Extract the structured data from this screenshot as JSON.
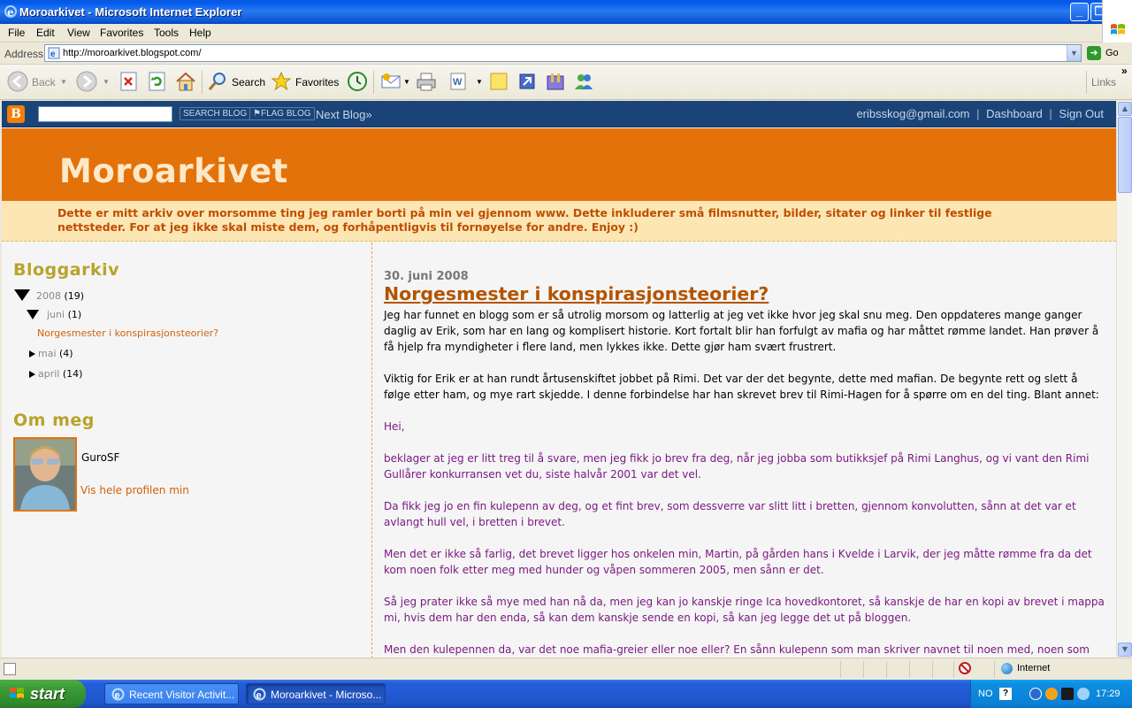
{
  "window": {
    "title": "Moroarkivet - Microsoft Internet Explorer",
    "min_glyph": "_",
    "max_glyph": "❐",
    "close_glyph": "✕"
  },
  "menu": {
    "items": [
      "File",
      "Edit",
      "View",
      "Favorites",
      "Tools",
      "Help"
    ]
  },
  "address": {
    "label": "Address",
    "url": "http://moroarkivet.blogspot.com/",
    "go_label": "Go"
  },
  "toolbar": {
    "back_label": "Back",
    "search_label": "Search",
    "favorites_label": "Favorites",
    "links_label": "Links",
    "more_glyph": "»"
  },
  "blogger_navbar": {
    "search_button": "SEARCH BLOG",
    "flag_button": "⚑FLAG BLOG",
    "next_blog": "Next Blog»",
    "user_email": "eribsskog@gmail.com",
    "dashboard": "Dashboard",
    "sign_out": "Sign Out",
    "separator": "|",
    "logo_letter": "B"
  },
  "blog": {
    "title": "Moroarkivet",
    "description": "Dette er mitt arkiv over morsomme ting jeg ramler borti på min vei gjennom www. Dette inkluderer små filmsnutter, bilder, sitater og linker til festlige nettsteder. For at jeg ikke skal miste dem, og forhåpentligvis til fornøyelse for andre. Enjoy :)"
  },
  "sidebar": {
    "archive_heading": "Bloggarkiv",
    "archive": {
      "year": "2008",
      "year_count": "(19)",
      "months": [
        {
          "name": "juni",
          "count": "(1)",
          "post": "Norgesmester i konspirasjonsteorier?"
        },
        {
          "name": "mai",
          "count": "(4)"
        },
        {
          "name": "april",
          "count": "(14)"
        }
      ]
    },
    "about_heading": "Om meg",
    "profile_name": "GuroSF",
    "profile_link": "Vis hele profilen min"
  },
  "post": {
    "date": "30. juni 2008",
    "title": "Norgesmester i konspirasjonsteorier?",
    "intro1": "Jeg har funnet en blogg som er så utrolig morsom og latterlig at jeg vet ikke hvor jeg skal snu meg. Den oppdateres mange ganger daglig av Erik, som har en lang og komplisert historie. Kort fortalt blir han forfulgt av mafia og har måttet rømme landet. Han prøver å få hjelp fra myndigheter i flere land, men lykkes ikke. Dette gjør ham svært frustrert.",
    "intro2": "Viktig for Erik er at han rundt årtusenskiftet jobbet på Rimi. Det var der det begynte, dette med mafian. De begynte rett og slett å følge etter ham, og mye rart skjedde. I denne forbindelse har han skrevet brev til Rimi-Hagen for å spørre om en del ting. Blant annet:",
    "quote": [
      "Hei,",
      "beklager at jeg er litt treg til å svare, men jeg fikk jo brev fra deg, når jeg jobba som butikksjef på Rimi Langhus, og vi vant den Rimi Gullårer konkurransen vet du, siste halvår 2001 var det vel.",
      "Da fikk jeg jo en fin kulepenn av deg, og et fint brev, som dessverre var slitt litt i bretten, gjennom konvolutten, sånn at det var et avlangt hull vel, i bretten i brevet.",
      "Men det er ikke så farlig, det brevet ligger hos onkelen min, Martin, på gården hans i Kvelde i Larvik, der jeg måtte rømme fra da det kom noen folk etter meg med hunder og våpen sommeren 2005, men sånn er det.",
      "Så jeg prater ikke så mye med han nå da, men jeg kan jo kanskje ringe Ica hovedkontoret, så kanskje de har en kopi av brevet i mappa mi, hvis dem har den enda, så kan dem kanskje sende en kopi, så kan jeg legge det ut på bloggen.",
      "Men den kulepennen da, var det noe mafia-greier eller noe eller? En sånn kulepenn som man skriver navnet til noen med, noen som man"
    ]
  },
  "statusbar": {
    "zone": "Internet"
  },
  "taskbar": {
    "start_label": "start",
    "tasks": [
      {
        "label": "Recent Visitor Activit..."
      },
      {
        "label": "Moroarkivet - Microso..."
      }
    ],
    "tray_lang": "NO",
    "tray_help": "?",
    "clock": "17:29"
  },
  "colors": {
    "header_orange": "#e3720a",
    "description_bg": "#fce7b4",
    "navbar_blue": "#1a4477",
    "sidebar_heading": "#b8a32a",
    "link_orange": "#d3620a",
    "quote_purple": "#7a1a82"
  }
}
